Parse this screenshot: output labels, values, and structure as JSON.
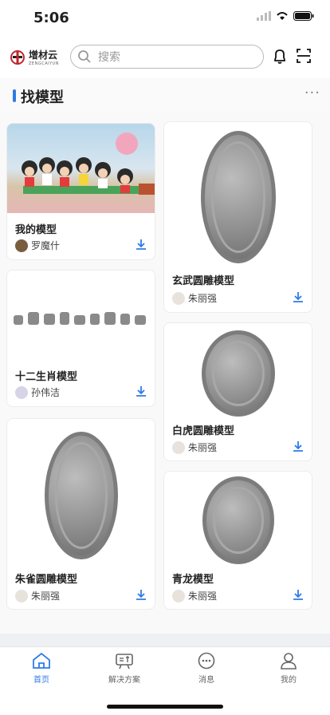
{
  "status": {
    "time": "5:06"
  },
  "header": {
    "logo_name": "增材云",
    "logo_sub": "ZENGCAIYUN",
    "search_placeholder": "搜索"
  },
  "section": {
    "title": "找模型",
    "more": "···"
  },
  "cards": [
    {
      "title": "我的模型",
      "author": "罗魔什"
    },
    {
      "title": "十二生肖模型",
      "author": "孙伟洁"
    },
    {
      "title": "朱雀圆雕模型",
      "author": "朱丽强"
    },
    {
      "title": "玄武圆雕模型",
      "author": "朱丽强"
    },
    {
      "title": "白虎圆雕模型",
      "author": "朱丽强"
    },
    {
      "title": "青龙模型",
      "author": "朱丽强"
    }
  ],
  "tabs": [
    {
      "label": "首页",
      "icon": "home-icon"
    },
    {
      "label": "解决方案",
      "icon": "solution-icon"
    },
    {
      "label": "消息",
      "icon": "message-icon"
    },
    {
      "label": "我的",
      "icon": "profile-icon"
    }
  ],
  "colors": {
    "accent": "#2f7be6"
  }
}
